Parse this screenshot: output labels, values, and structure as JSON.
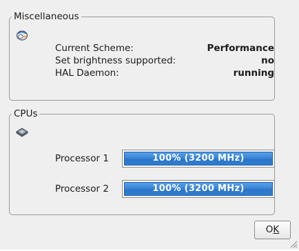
{
  "misc": {
    "title": "Miscellaneous",
    "icon": "power-profile-icon",
    "rows": [
      {
        "label": "Current Scheme:",
        "value": "Performance"
      },
      {
        "label": "Set brightness supported:",
        "value": "no"
      },
      {
        "label": "HAL Daemon:",
        "value": "running"
      }
    ]
  },
  "cpus": {
    "title": "CPUs",
    "icon": "cpu-chip-icon",
    "processors": [
      {
        "label": "Processor 1",
        "text": "100% (3200 MHz)",
        "percent": 100
      },
      {
        "label": "Processor 2",
        "text": "100% (3200 MHz)",
        "percent": 100
      }
    ]
  },
  "buttons": {
    "ok_prefix": "O",
    "ok_mnemonic": "K"
  },
  "colors": {
    "progress_fill": "#3b86d8",
    "window_bg": "#efefef"
  }
}
